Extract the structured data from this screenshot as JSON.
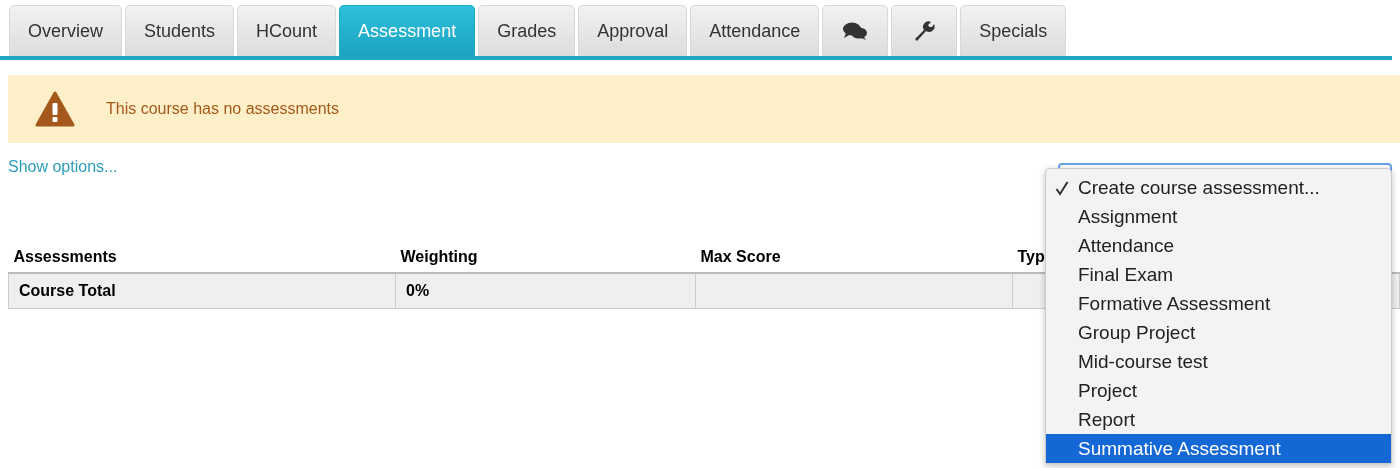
{
  "tabs": [
    {
      "kind": "text",
      "label": "Overview",
      "selected": false
    },
    {
      "kind": "text",
      "label": "Students",
      "selected": false
    },
    {
      "kind": "text",
      "label": "HCount",
      "selected": false
    },
    {
      "kind": "text",
      "label": "Assessment",
      "selected": true
    },
    {
      "kind": "text",
      "label": "Grades",
      "selected": false
    },
    {
      "kind": "text",
      "label": "Approval",
      "selected": false
    },
    {
      "kind": "text",
      "label": "Attendance",
      "selected": false
    },
    {
      "kind": "chat",
      "selected": false
    },
    {
      "kind": "wrench",
      "selected": false
    },
    {
      "kind": "text",
      "label": "Specials",
      "selected": false
    }
  ],
  "alert": {
    "message": "This course has no assessments"
  },
  "show_options": "Show options...",
  "table": {
    "columns": [
      "Assessments",
      "Weighting",
      "Max Score",
      "Typ"
    ],
    "rows": [
      {
        "cells": [
          "Course Total",
          "0%"
        ]
      }
    ]
  },
  "dropdown": {
    "items": [
      {
        "label": "Create course assessment...",
        "checked": true,
        "selected": false
      },
      {
        "label": "Assignment",
        "checked": false,
        "selected": false
      },
      {
        "label": "Attendance",
        "checked": false,
        "selected": false
      },
      {
        "label": "Final Exam",
        "checked": false,
        "selected": false
      },
      {
        "label": "Formative Assessment",
        "checked": false,
        "selected": false
      },
      {
        "label": "Group Project",
        "checked": false,
        "selected": false
      },
      {
        "label": "Mid-course test",
        "checked": false,
        "selected": false
      },
      {
        "label": "Project",
        "checked": false,
        "selected": false
      },
      {
        "label": "Report",
        "checked": false,
        "selected": false
      },
      {
        "label": "Summative Assessment",
        "checked": false,
        "selected": true
      }
    ]
  }
}
